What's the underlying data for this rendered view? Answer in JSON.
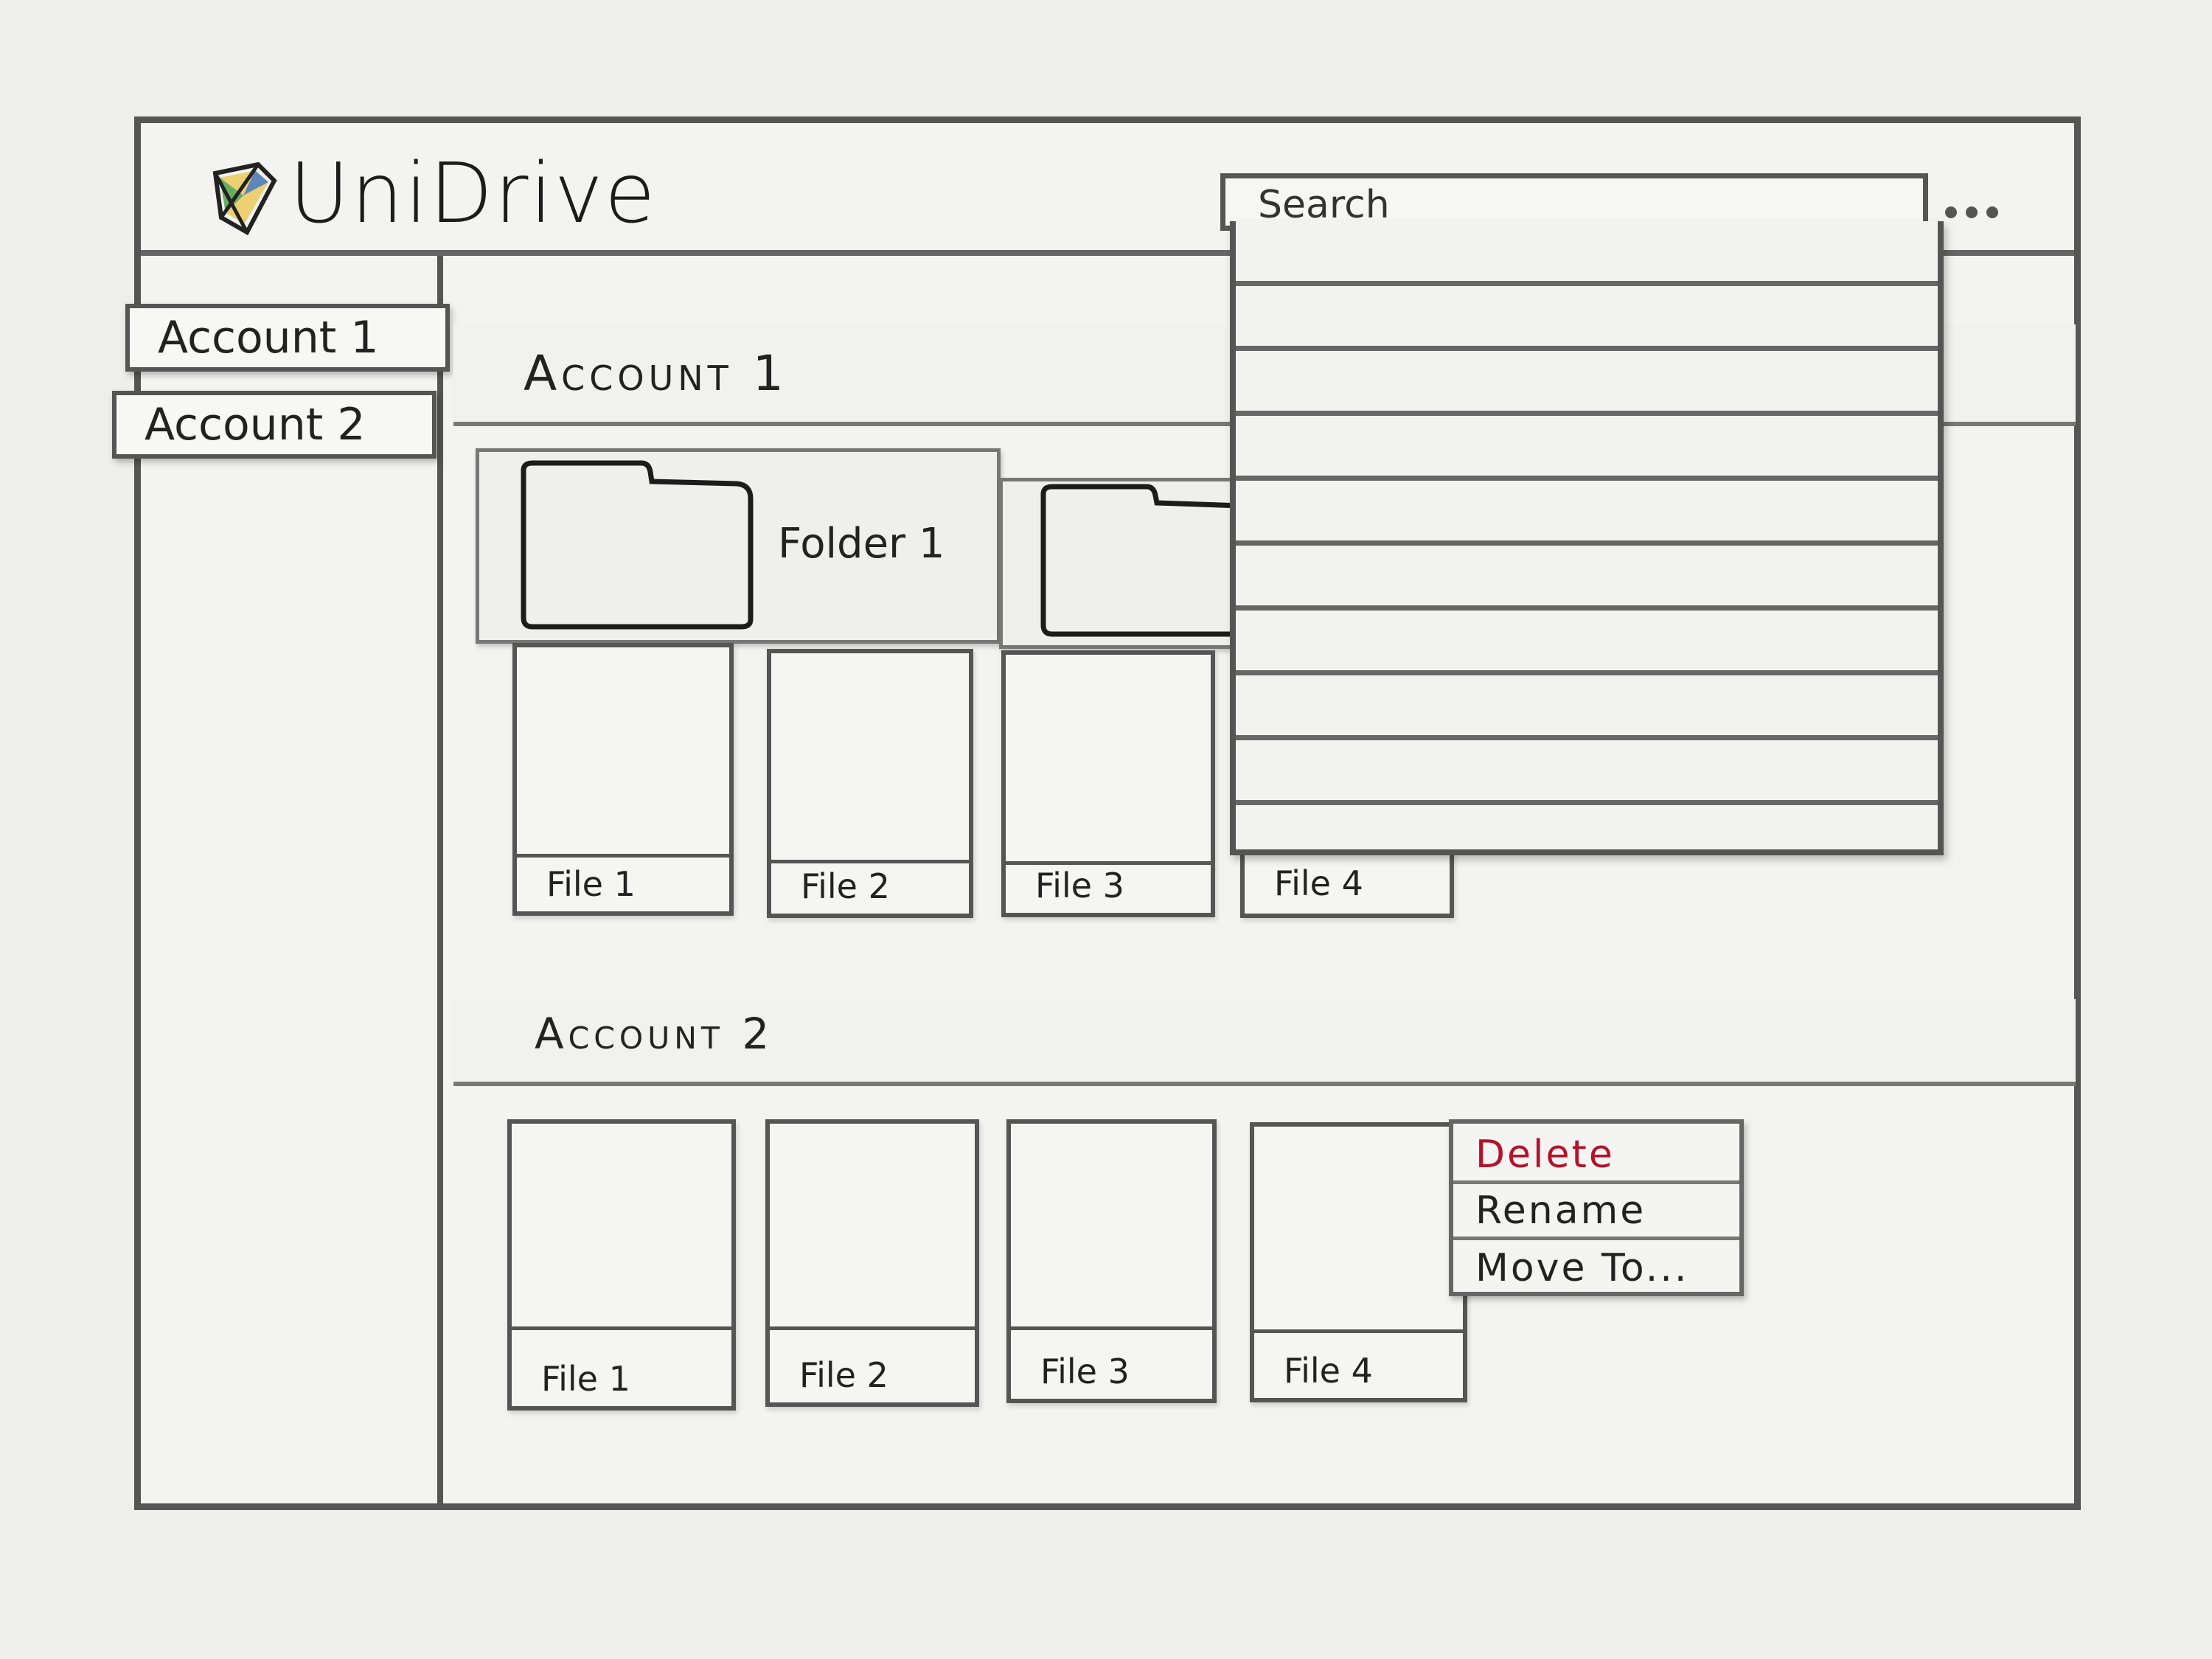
{
  "app": {
    "title": "UniDrive",
    "logo_icon": "drive-logo-icon"
  },
  "header": {
    "search": {
      "placeholder": "Search"
    },
    "more_icon": "more-dots-icon"
  },
  "sidebar": {
    "items": [
      {
        "label": "Account 1"
      },
      {
        "label": "Account 2"
      }
    ]
  },
  "main": {
    "sections": [
      {
        "title": "Account 1",
        "folders": [
          {
            "label": "Folder 1",
            "icon": "folder-icon"
          },
          {
            "label": "",
            "icon": "folder-icon"
          }
        ],
        "files": [
          {
            "label": "File 1"
          },
          {
            "label": "File 2"
          },
          {
            "label": "File 3"
          },
          {
            "label": "File 4"
          }
        ]
      },
      {
        "title": "Account 2",
        "files": [
          {
            "label": "File 1"
          },
          {
            "label": "File 2"
          },
          {
            "label": "File 3"
          },
          {
            "label": "File 4"
          }
        ]
      }
    ]
  },
  "search_dropdown": {
    "row_count": 10
  },
  "context_menu": {
    "items": [
      {
        "label": "Delete",
        "color": "#b4122a"
      },
      {
        "label": "Rename"
      },
      {
        "label": "Move To..."
      }
    ]
  }
}
